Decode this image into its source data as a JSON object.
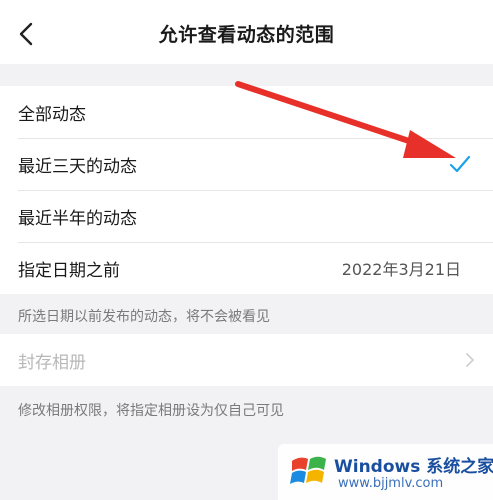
{
  "header": {
    "title": "允许查看动态的范围"
  },
  "options": [
    {
      "label": "全部动态"
    },
    {
      "label": "最近三天的动态",
      "selected": true
    },
    {
      "label": "最近半年的动态"
    },
    {
      "label": "指定日期之前",
      "value": "2022年3月21日"
    }
  ],
  "notes": {
    "date_note": "所选日期以前发布的动态，将不会被看见",
    "archive_note": "修改相册权限，将指定相册设为仅自己可见"
  },
  "archive": {
    "label": "封存相册"
  },
  "watermark": {
    "brand": "Windows",
    "brand_cn": "系统之家",
    "url": "www.bjjmlv.com"
  },
  "colors": {
    "accent": "#1aa3e8",
    "annotation_arrow": "#e8302a"
  },
  "icons": {
    "back": "chevron-left-icon",
    "check": "checkmark-icon",
    "archive_chevron": "chevron-right-icon",
    "annotation": "red-arrow"
  }
}
